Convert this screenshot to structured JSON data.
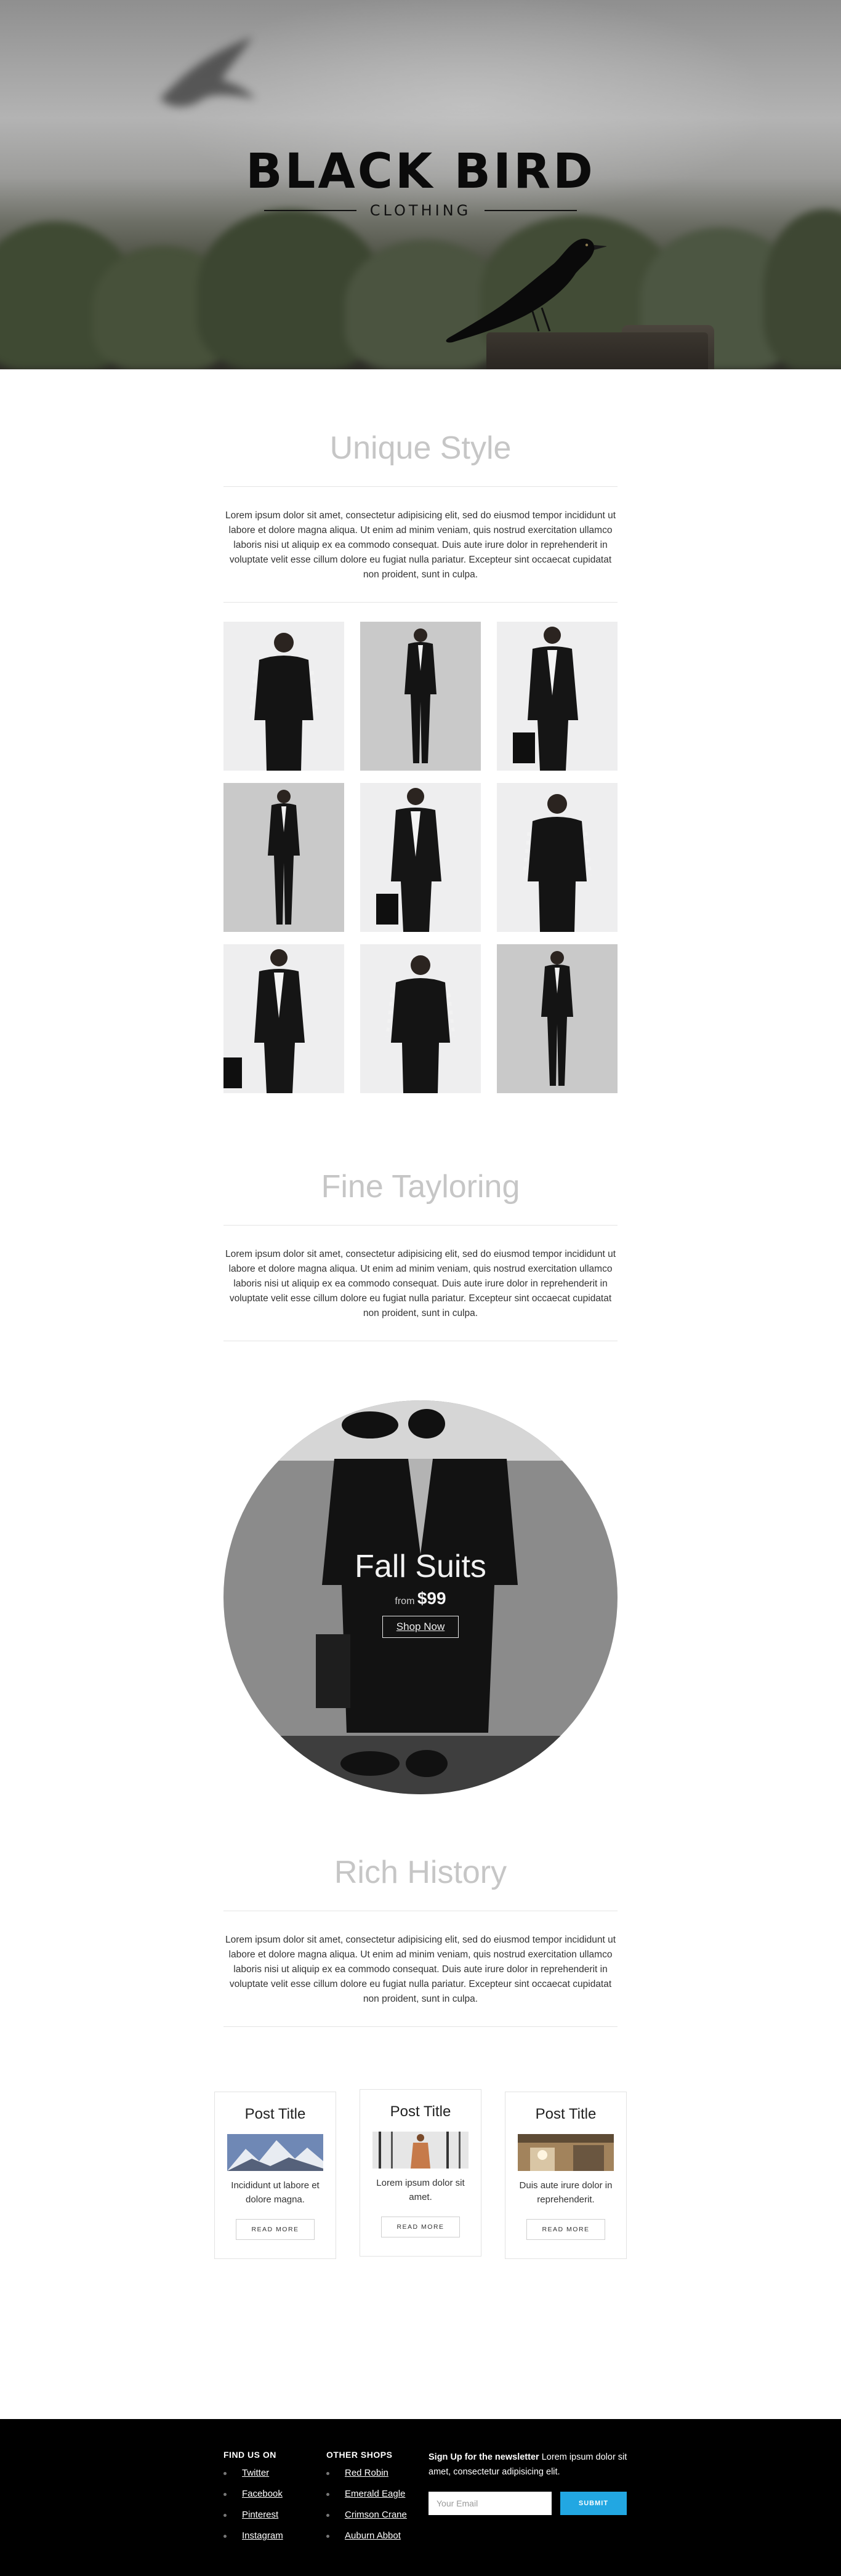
{
  "brand": {
    "title": "BLACK BIRD",
    "subtitle": "CLOTHING"
  },
  "sections": [
    {
      "title": "Unique Style",
      "text": "Lorem ipsum dolor sit amet, consectetur adipisicing elit, sed do eiusmod tempor incididunt ut labore et dolore magna aliqua. Ut enim ad minim veniam, quis nostrud exercitation ullamco laboris nisi ut aliquip ex ea commodo consequat. Duis aute irure dolor in reprehenderit in voluptate velit esse cillum dolore eu fugiat nulla pariatur. Excepteur sint occaecat cupidatat non proident, sunt in culpa."
    },
    {
      "title": "Fine Tayloring",
      "text": "Lorem ipsum dolor sit amet, consectetur adipisicing elit, sed do eiusmod tempor incididunt ut labore et dolore magna aliqua. Ut enim ad minim veniam, quis nostrud exercitation ullamco laboris nisi ut aliquip ex ea commodo consequat. Duis aute irure dolor in reprehenderit in voluptate velit esse cillum dolore eu fugiat nulla pariatur. Excepteur sint occaecat cupidatat non proident, sunt in culpa."
    },
    {
      "title": "Rich History",
      "text": "Lorem ipsum dolor sit amet, consectetur adipisicing elit, sed do eiusmod tempor incididunt ut labore et dolore magna aliqua. Ut enim ad minim veniam, quis nostrud exercitation ullamco laboris nisi ut aliquip ex ea commodo consequat. Duis aute irure dolor in reprehenderit in voluptate velit esse cillum dolore eu fugiat nulla pariatur. Excepteur sint occaecat cupidatat non proident, sunt in culpa."
    }
  ],
  "promo": {
    "title": "Fall Suits",
    "from_label": "from",
    "price": "$99",
    "button": "Shop Now"
  },
  "posts": [
    {
      "title": "Post Title",
      "text": "Incididunt ut labore et dolore magna.",
      "button": "READ MORE"
    },
    {
      "title": "Post Title",
      "text": "Lorem ipsum dolor sit amet.",
      "button": "READ MORE"
    },
    {
      "title": "Post Title",
      "text": "Duis aute irure dolor in reprehenderit.",
      "button": "READ MORE"
    }
  ],
  "footer": {
    "find_us": {
      "heading": "FIND US ON",
      "links": [
        "Twitter",
        "Facebook",
        "Pinterest",
        "Instagram"
      ]
    },
    "other_shops": {
      "heading": "OTHER SHOPS",
      "links": [
        "Red Robin",
        "Emerald Eagle",
        "Crimson Crane",
        "Auburn Abbot"
      ]
    },
    "newsletter": {
      "heading": "Sign Up for the newsletter",
      "text": "Lorem ipsum dolor sit amet, consectetur adipisicing elit.",
      "email_placeholder": "Your Email",
      "submit": "SUBMIT"
    }
  },
  "colors": {
    "accent": "#22a7e2",
    "title_gray": "#c6c6c6",
    "footer_bg": "#000000"
  },
  "icons": [
    "bird-logo-illustration",
    "bullet-dot-icon"
  ]
}
